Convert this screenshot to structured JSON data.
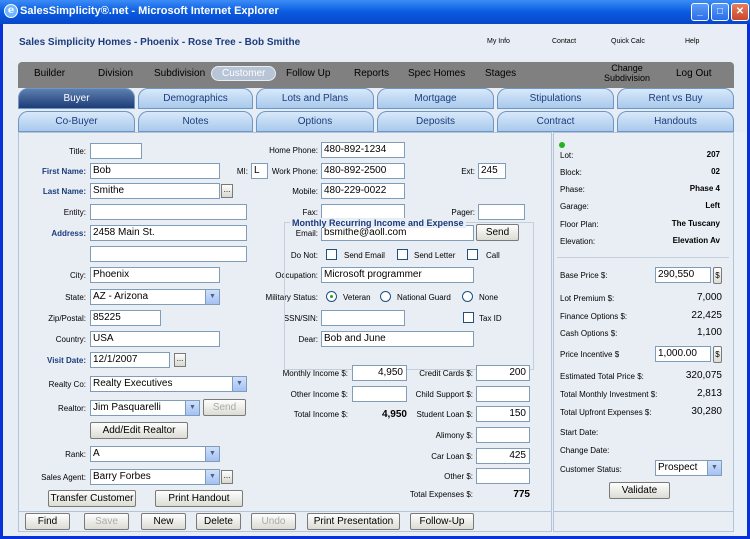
{
  "window": {
    "title": "SalesSimplicity®.net - Microsoft Internet Explorer"
  },
  "header": {
    "breadcrumb": "Sales Simplicity Homes - Phoenix - Rose Tree - Bob Smithe",
    "links": [
      "My Info",
      "Contact",
      "Quick Calc",
      "Help"
    ]
  },
  "nav": {
    "items": [
      "Builder",
      "Division",
      "Subdivision",
      "Customer",
      "Follow Up",
      "Reports",
      "Spec Homes",
      "Stages"
    ],
    "change_subdivision": [
      "Change",
      "Subdivision"
    ],
    "logout": "Log Out"
  },
  "tabs": {
    "row1": [
      "Buyer",
      "Demographics",
      "Lots and Plans",
      "Mortgage",
      "Stipulations",
      "Rent vs Buy"
    ],
    "row2": [
      "Co-Buyer",
      "Notes",
      "Options",
      "Deposits",
      "Contract",
      "Handouts"
    ]
  },
  "form": {
    "title_label": "Title:",
    "title_value": "",
    "first_name_label": "First Name:",
    "first_name": "Bob",
    "mi_label": "MI:",
    "mi": "L",
    "last_name_label": "Last Name:",
    "last_name": "Smithe",
    "entity_label": "Entity:",
    "entity": "",
    "address_label": "Address:",
    "address1": "2458 Main St.",
    "address2": "",
    "city_label": "City:",
    "city": "Phoenix",
    "state_label": "State:",
    "state": "AZ - Arizona",
    "zip_label": "Zip/Postal:",
    "zip": "85225",
    "country_label": "Country:",
    "country": "USA",
    "visit_label": "Visit Date:",
    "visit_date": "12/1/2007",
    "realty_label": "Realty Co:",
    "realty": "Realty Executives",
    "realtor_label": "Realtor:",
    "realtor": "Jim Pasquarelli",
    "send_disabled": "Send",
    "add_edit_realtor": "Add/Edit Realtor",
    "rank_label": "Rank:",
    "rank": "A",
    "agent_label": "Sales Agent:",
    "agent": "Barry Forbes",
    "transfer": "Transfer Customer",
    "print_handout": "Print Handout",
    "home_phone_label": "Home Phone:",
    "home_phone": "480-892-1234",
    "work_phone_label": "Work Phone:",
    "work_phone": "480-892-2500",
    "ext_label": "Ext:",
    "ext": "245",
    "mobile_label": "Mobile:",
    "mobile": "480-229-0022",
    "fax_label": "Fax:",
    "fax": "",
    "pager_label": "Pager:",
    "pager": "",
    "email_label": "Email:",
    "email": "bsmithe@aoll.com",
    "email_send": "Send",
    "donot_label": "Do Not:",
    "donot_options": [
      "Send Email",
      "Send Letter",
      "Call"
    ],
    "occupation_label": "Occupation:",
    "occupation": "Microsoft programmer",
    "military_label": "Military Status:",
    "military_options": [
      "Veteran",
      "National Guard",
      "None"
    ],
    "military_selected": "Veteran",
    "ssn_label": "SSN/SIN:",
    "ssn": "",
    "taxid_label": "Tax ID",
    "dear_label": "Dear:",
    "dear": "Bob and June"
  },
  "income": {
    "title": "Monthly Recurring Income and Expense",
    "monthly_income_label": "Monthly Income $:",
    "monthly_income": "4,950",
    "other_income_label": "Other Income $:",
    "other_income": "",
    "total_income_label": "Total Income $:",
    "total_income": "4,950",
    "credit_cards_label": "Credit Cards $:",
    "credit_cards": "200",
    "child_support_label": "Child Support $:",
    "child_support": "",
    "student_loan_label": "Student Loan $:",
    "student_loan": "150",
    "alimony_label": "Alimony $:",
    "alimony": "",
    "car_loan_label": "Car Loan $:",
    "car_loan": "425",
    "other_label": "Other $:",
    "other": "",
    "total_expenses_label": "Total Expenses $:",
    "total_expenses": "775"
  },
  "lot": {
    "lot_label": "Lot:",
    "lot": "207",
    "block_label": "Block:",
    "block": "02",
    "phase_label": "Phase:",
    "phase": "Phase 4",
    "garage_label": "Garage:",
    "garage": "Left",
    "floor_label": "Floor Plan:",
    "floor": "The Tuscany",
    "elevation_label": "Elevation:",
    "elevation": "Elevation Av"
  },
  "pricing": {
    "base_label": "Base Price $:",
    "base": "290,550",
    "lot_premium_label": "Lot Premium $:",
    "lot_premium": "7,000",
    "finance_label": "Finance Options $:",
    "finance": "22,425",
    "cash_label": "Cash Options $:",
    "cash": "1,100",
    "incentive_label": "Price Incentive $",
    "incentive": "1,000.00",
    "est_total_label": "Estimated Total Price $:",
    "est_total": "320,075",
    "monthly_inv_label": "Total Monthly Investment $:",
    "monthly_inv": "2,813",
    "upfront_label": "Total Upfront Expenses $:",
    "upfront": "30,280",
    "start_label": "Start Date:",
    "change_label": "Change Date:",
    "status_label": "Customer Status:",
    "status": "Prospect",
    "dollar_btn": "$",
    "validate": "Validate"
  },
  "bottom": {
    "buttons": [
      "Find",
      "Save",
      "New",
      "Delete",
      "Undo",
      "Print Presentation",
      "Follow-Up"
    ]
  }
}
